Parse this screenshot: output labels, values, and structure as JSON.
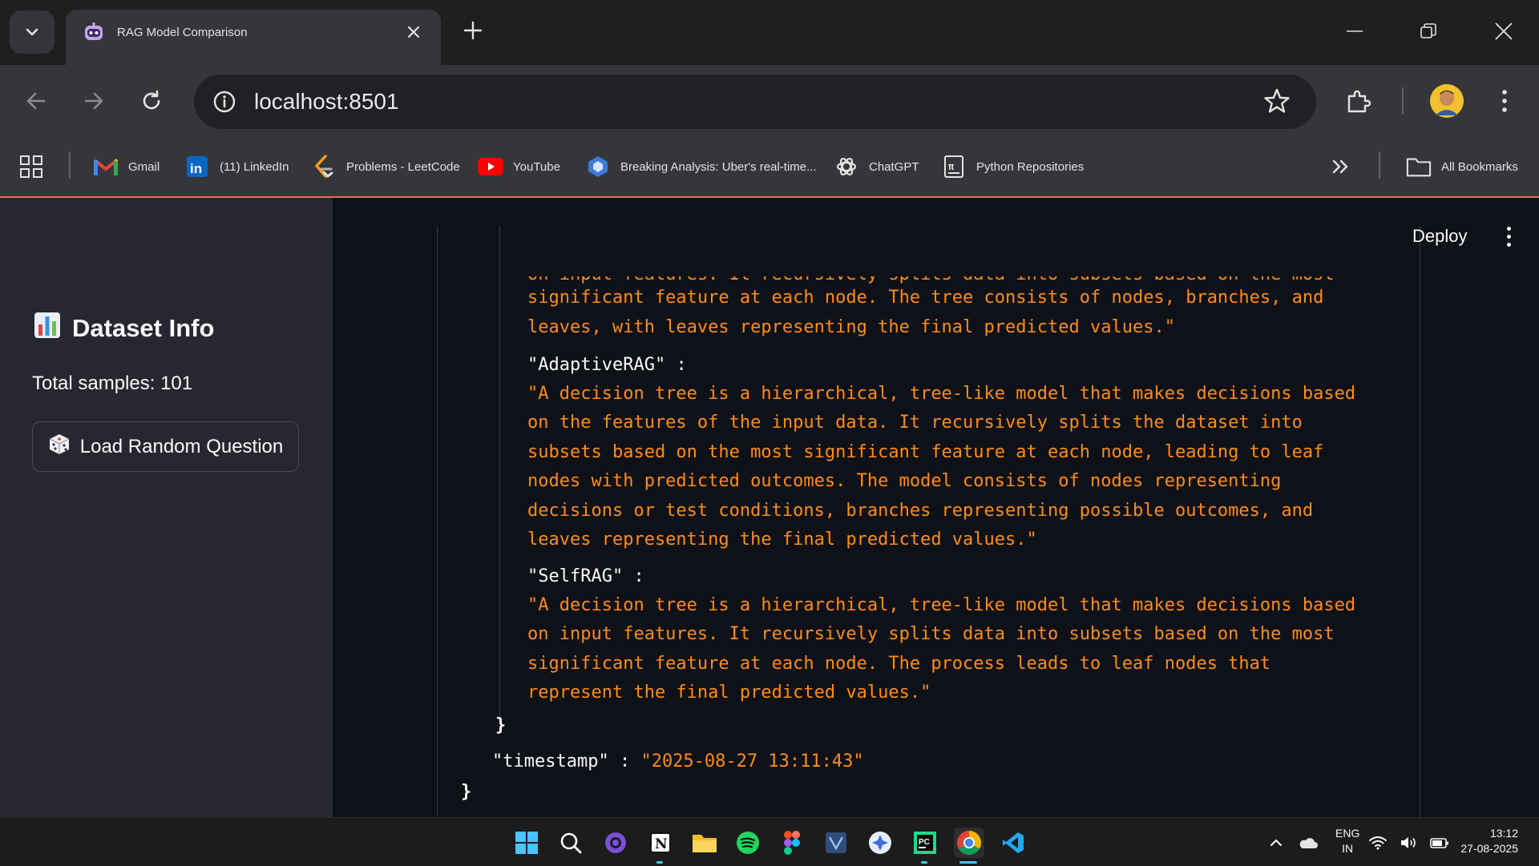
{
  "browser": {
    "tab_title": "RAG Model Comparison",
    "url": "localhost:8501",
    "bookmarks": [
      {
        "label": "Gmail",
        "icon": "gmail-icon"
      },
      {
        "label": "(11) LinkedIn",
        "icon": "linkedin-icon"
      },
      {
        "label": "Problems - LeetCode",
        "icon": "leetcode-icon"
      },
      {
        "label": "YouTube",
        "icon": "youtube-icon"
      },
      {
        "label": "Breaking Analysis: Uber's real-time...",
        "icon": "article-icon"
      },
      {
        "label": "ChatGPT",
        "icon": "chatgpt-icon"
      },
      {
        "label": "Python Repositories",
        "icon": "repo-icon"
      }
    ],
    "all_bookmarks_label": "All Bookmarks",
    "accent_color": "#e8704a"
  },
  "sidebar": {
    "title": "Dataset Info",
    "title_icon": "bar-chart-icon",
    "total_samples": "Total samples: 101",
    "load_button_label": "Load Random Question",
    "load_button_icon": "dice-icon"
  },
  "main": {
    "deploy_label": "Deploy",
    "json_view": {
      "partial_top_line": "on input features. It recursively splits data into subsets based on the most",
      "first_answer_lines": [
        "significant feature at each node. The tree consists of nodes, branches, and",
        "leaves, with leaves representing the final predicted values.\""
      ],
      "entries": [
        {
          "key": "\"AdaptiveRAG\"",
          "lines": [
            "\"A decision tree is a hierarchical, tree-like model that makes decisions based",
            "on the features of the input data. It recursively splits the dataset into",
            "subsets based on the most significant feature at each node, leading to leaf",
            "nodes with predicted outcomes. The model consists of nodes representing",
            "decisions or test conditions, branches representing possible outcomes, and",
            "leaves representing the final predicted values.\""
          ]
        },
        {
          "key": "\"SelfRAG\"",
          "lines": [
            "\"A decision tree is a hierarchical, tree-like model that makes decisions based",
            "on input features. It recursively splits data into subsets based on the most",
            "significant feature at each node. The process leads to leaf nodes that",
            "represent the final predicted values.\""
          ]
        }
      ],
      "close_inner": "}",
      "timestamp_key": "\"timestamp\"",
      "timestamp_value": "\"2025-08-27 13:11:43\"",
      "close_outer": "}",
      "colon": ":",
      "string_color": "#ff8c1a"
    }
  },
  "taskbar": {
    "apps": [
      "windows-start-icon",
      "search-icon",
      "github-desktop-icon",
      "notion-icon",
      "file-explorer-icon",
      "spotify-icon",
      "figma-icon",
      "app-icon",
      "assistant-icon",
      "pycharm-icon",
      "chrome-icon",
      "vscode-icon"
    ],
    "lang_top": "ENG",
    "lang_bottom": "IN",
    "time": "13:12",
    "date": "27-08-2025"
  }
}
